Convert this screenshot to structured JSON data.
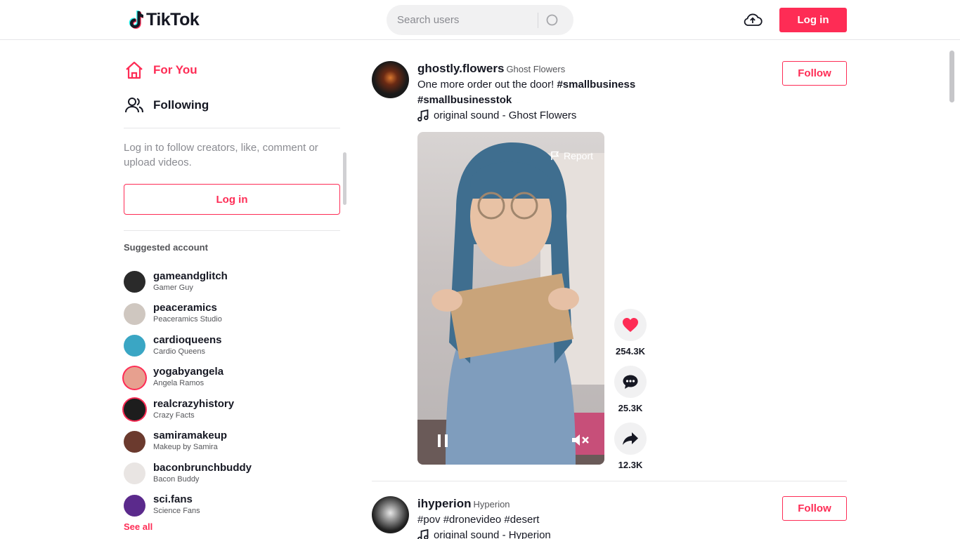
{
  "header": {
    "logo_text": "TikTok",
    "search_placeholder": "Search users",
    "login_label": "Log in"
  },
  "sidebar": {
    "nav": [
      {
        "label": "For You",
        "icon": "home-icon",
        "active": true
      },
      {
        "label": "Following",
        "icon": "users-icon",
        "active": false
      }
    ],
    "login_hint": "Log in to follow creators, like, comment or upload videos.",
    "login_label": "Log in",
    "suggested_title": "Suggested account",
    "accounts": [
      {
        "user": "gameandglitch",
        "name": "Gamer Guy",
        "color": "#2a2a2a"
      },
      {
        "user": "peaceramics",
        "name": "Peaceramics Studio",
        "color": "#cfc7c0"
      },
      {
        "user": "cardioqueens",
        "name": "Cardio Queens",
        "color": "#3aa6c4"
      },
      {
        "user": "yogabyangela",
        "name": "Angela Ramos",
        "color": "#e7a08f"
      },
      {
        "user": "realcrazyhistory",
        "name": "Crazy Facts",
        "color": "#1d1d1d"
      },
      {
        "user": "samiramakeup",
        "name": "Makeup by Samira",
        "color": "#6b3a2e"
      },
      {
        "user": "baconbrunchbuddy",
        "name": "Bacon Buddy",
        "color": "#e9e5e3"
      },
      {
        "user": "sci.fans",
        "name": "Science Fans",
        "color": "#5b2a8c"
      }
    ],
    "see_all": "See all"
  },
  "posts": [
    {
      "user": "ghostly.flowers",
      "name": "Ghost Flowers",
      "caption_prefix": "One more order out the door!",
      "tag1": "#smallbusiness",
      "tag2": "#smallbusinesstok",
      "sound": "original sound - Ghost Flowers",
      "follow_label": "Follow",
      "report_label": "Report",
      "likes": "254.3K",
      "comments": "25.3K",
      "shares": "12.3K"
    },
    {
      "user": "ihyperion",
      "name": "Hyperion",
      "caption": "#pov #dronevideo #desert",
      "sound": "original sound - Hyperion",
      "follow_label": "Follow"
    }
  ],
  "colors": {
    "accent": "#fe2c55",
    "text": "#161823",
    "muted": "#8a8b91"
  }
}
